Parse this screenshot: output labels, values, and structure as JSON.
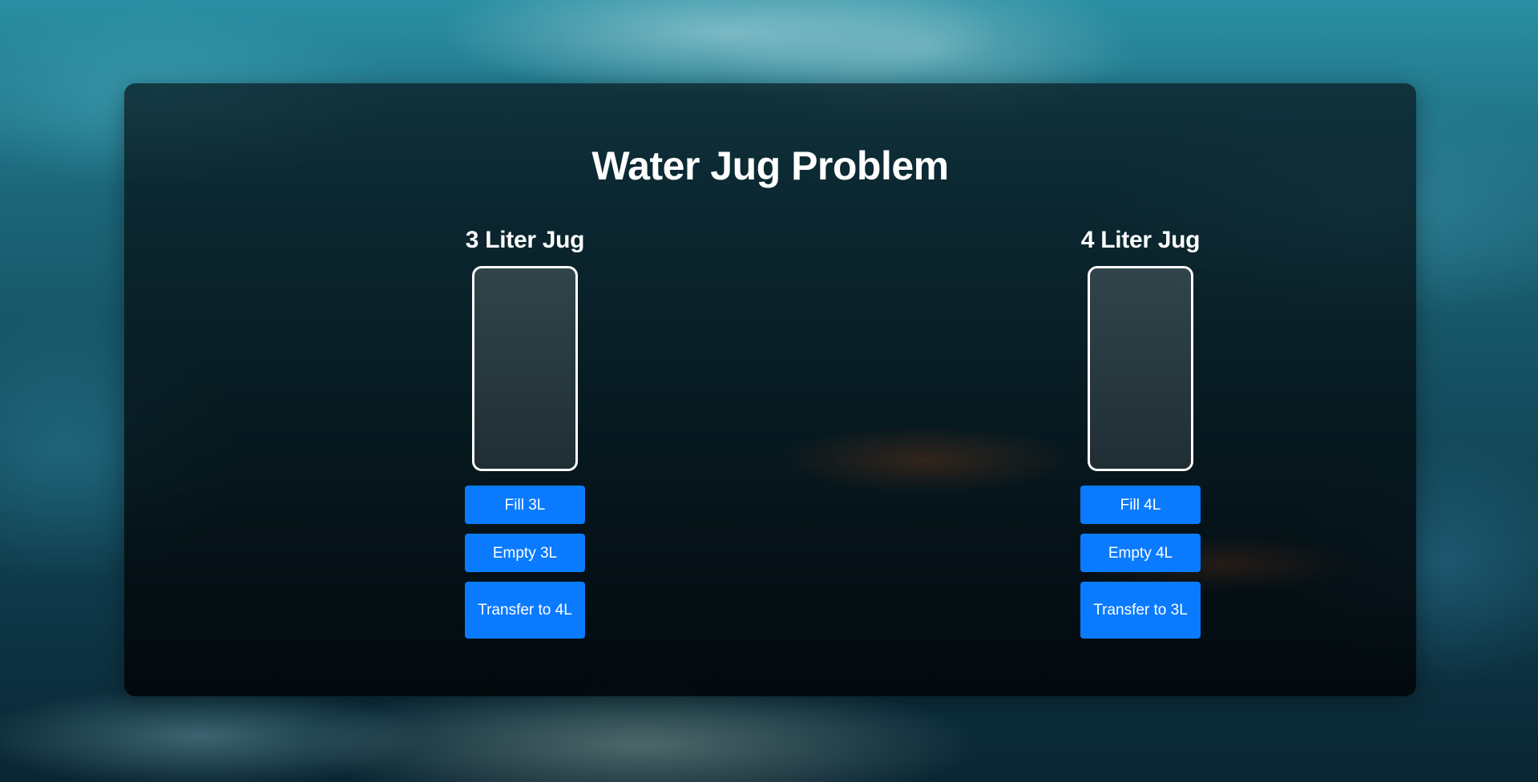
{
  "app": {
    "title": "Water Jug Problem"
  },
  "jugs": [
    {
      "heading": "3 Liter Jug",
      "fill_fraction": 0,
      "buttons": {
        "fill": "Fill 3L",
        "empty": "Empty 3L",
        "transfer": "Transfer to 4L"
      }
    },
    {
      "heading": "4 Liter Jug",
      "fill_fraction": 0,
      "buttons": {
        "fill": "Fill 4L",
        "empty": "Empty 4L",
        "transfer": "Transfer to 3L"
      }
    }
  ],
  "colors": {
    "button": "#0a7bff",
    "jug_border": "#ffffff",
    "text": "#ffffff"
  }
}
